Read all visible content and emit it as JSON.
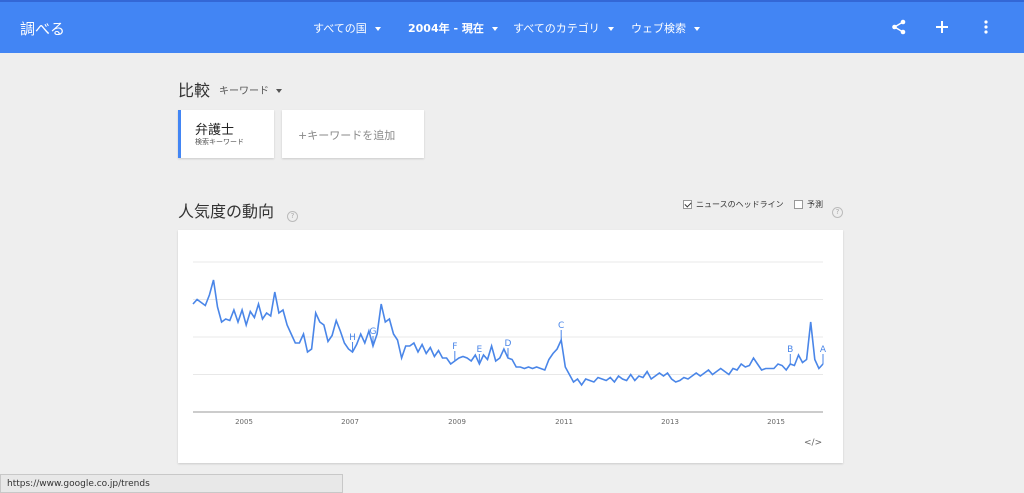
{
  "header": {
    "brand": "調べる",
    "filters": [
      {
        "label": "すべての国"
      },
      {
        "label": "2004年 - 現在"
      },
      {
        "label": "すべてのカテゴリ"
      },
      {
        "label": "ウェブ検索"
      }
    ],
    "icons": [
      "share-icon",
      "add-icon",
      "more-vert-icon"
    ]
  },
  "compare": {
    "title": "比較",
    "type_label": "キーワード",
    "keyword_card": {
      "term": "弁護士",
      "subtitle": "検索キーワード"
    },
    "add_placeholder": "+キーワードを追加"
  },
  "interest": {
    "title": "人気度の動向",
    "news_headlines_label": "ニュースのヘッドライン",
    "news_headlines_checked": true,
    "forecast_label": "予測",
    "forecast_checked": false,
    "embed_label": "</>"
  },
  "chart_data": {
    "type": "line",
    "series": [
      {
        "values": [
          72,
          75,
          73,
          71,
          78,
          88,
          70,
          60,
          62,
          61,
          68,
          60,
          68,
          58,
          67,
          63,
          72,
          62,
          66,
          64,
          80,
          66,
          68,
          58,
          52,
          46,
          46,
          52,
          40,
          42,
          66,
          60,
          58,
          47,
          51,
          61,
          54,
          46,
          42,
          40,
          45,
          52,
          46,
          54,
          44,
          52,
          72,
          60,
          62,
          52,
          48,
          36,
          44,
          44,
          46,
          40,
          45,
          39,
          43,
          37,
          41,
          36,
          36,
          32,
          34,
          36,
          37,
          36,
          34,
          38,
          32,
          38,
          35,
          44,
          34,
          36,
          42,
          36,
          35,
          30,
          30,
          29,
          30,
          29,
          30,
          29,
          28,
          35,
          39,
          42,
          48,
          30,
          25,
          20,
          22,
          18,
          22,
          21,
          20,
          23,
          22,
          21,
          23,
          20,
          24,
          22,
          21,
          25,
          21,
          24,
          23,
          27,
          22,
          24,
          26,
          24,
          26,
          22,
          20,
          21,
          23,
          22,
          24,
          26,
          24,
          26,
          28,
          25,
          27,
          29,
          27,
          25,
          29,
          28,
          32,
          30,
          31,
          36,
          32,
          28,
          29,
          29,
          29,
          32,
          31,
          28,
          32,
          31,
          38,
          33,
          35,
          60,
          35,
          29,
          32
        ]
      }
    ],
    "x_ticks": [
      "2005",
      "2007",
      "2009",
      "2011",
      "2013",
      "2015"
    ],
    "annotations": [
      "H",
      "G",
      "F",
      "E",
      "D",
      "C",
      "B",
      "A"
    ],
    "grid": true,
    "legend": "none"
  },
  "statusbar": {
    "url": "https://www.google.co.jp/trends"
  }
}
